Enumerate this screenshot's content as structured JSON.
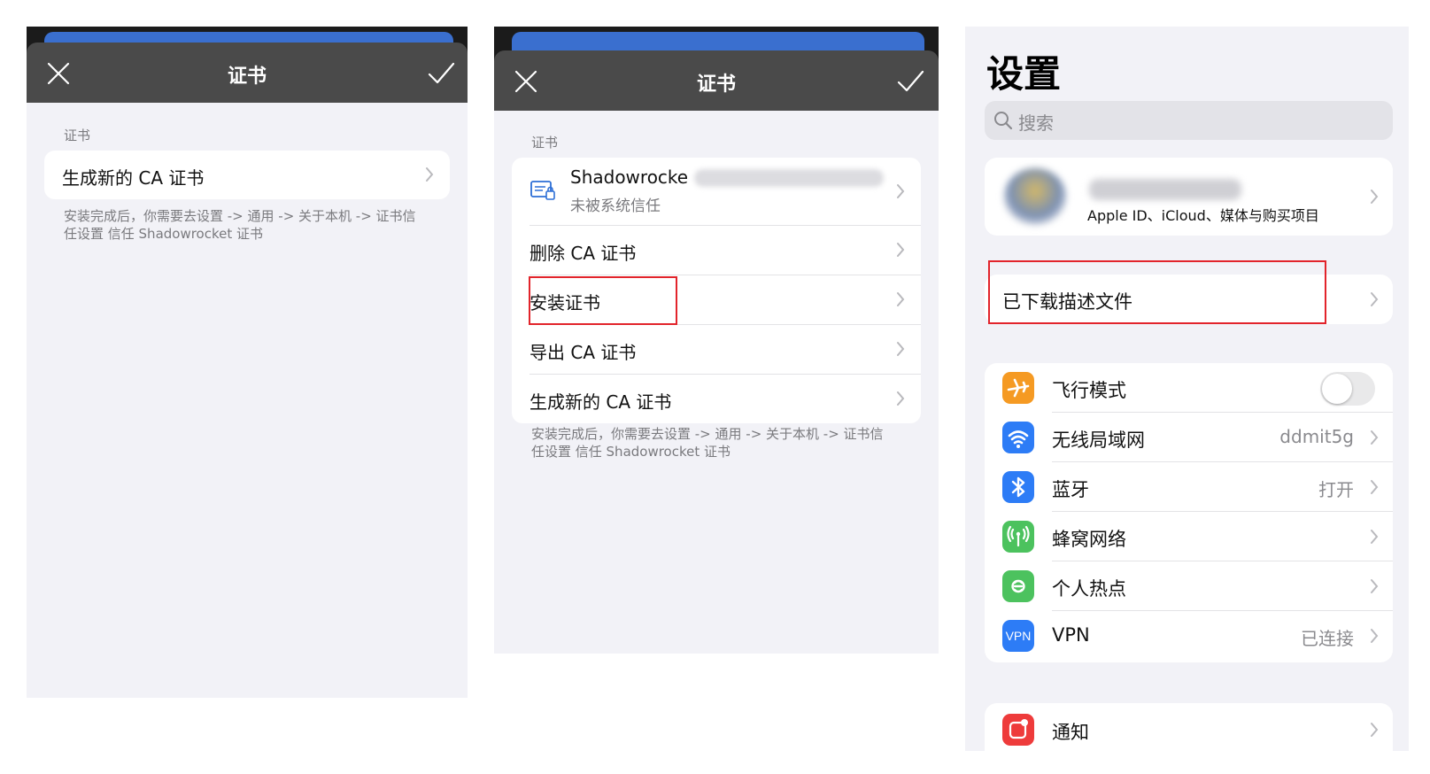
{
  "panel1": {
    "title": "证书",
    "section_label": "证书",
    "rows": [
      {
        "label": "生成新的 CA 证书"
      }
    ],
    "footer": "安装完成后，你需要去设置 -> 通用 -> 关于本机 -> 证书信任设置 信任 Shadowrocket 证书",
    "close_icon": "close-icon",
    "confirm_icon": "checkmark-icon"
  },
  "panel2": {
    "title": "证书",
    "section_label": "证书",
    "cert": {
      "name": "Shadowrocke",
      "status": "未被系统信任",
      "icon": "certificate-icon"
    },
    "rows": [
      {
        "label": "删除 CA 证书"
      },
      {
        "label": "安装证书"
      },
      {
        "label": "导出 CA 证书"
      },
      {
        "label": "生成新的 CA 证书"
      }
    ],
    "footer": "安装完成后，你需要去设置 -> 通用 -> 关于本机 -> 证书信任设置 信任 Shadowrocket 证书",
    "highlight_color": "#e2242b"
  },
  "panel3": {
    "title": "设置",
    "search_placeholder": "搜索",
    "account": {
      "subtitle": "Apple ID、iCloud、媒体与购买项目"
    },
    "downloaded_profile": "已下载描述文件",
    "rows": [
      {
        "label": "飞行模式",
        "icon": "airplane-icon",
        "color": "#f59a23",
        "toggle": false
      },
      {
        "label": "无线局域网",
        "value": "ddmit5g",
        "icon": "wifi-icon",
        "color": "#2d7cf6"
      },
      {
        "label": "蓝牙",
        "value": "打开",
        "icon": "bluetooth-icon",
        "color": "#2d7cf6"
      },
      {
        "label": "蜂窝网络",
        "icon": "cellular-icon",
        "color": "#4cc25e"
      },
      {
        "label": "个人热点",
        "icon": "hotspot-icon",
        "color": "#4cc25e"
      },
      {
        "label": "VPN",
        "value": "已连接",
        "icon": "vpn-icon",
        "icon_text": "VPN",
        "color": "#2d7cf6"
      }
    ],
    "next_row": {
      "label": "通知",
      "icon": "notification-icon",
      "color": "#ee3b3b"
    }
  }
}
